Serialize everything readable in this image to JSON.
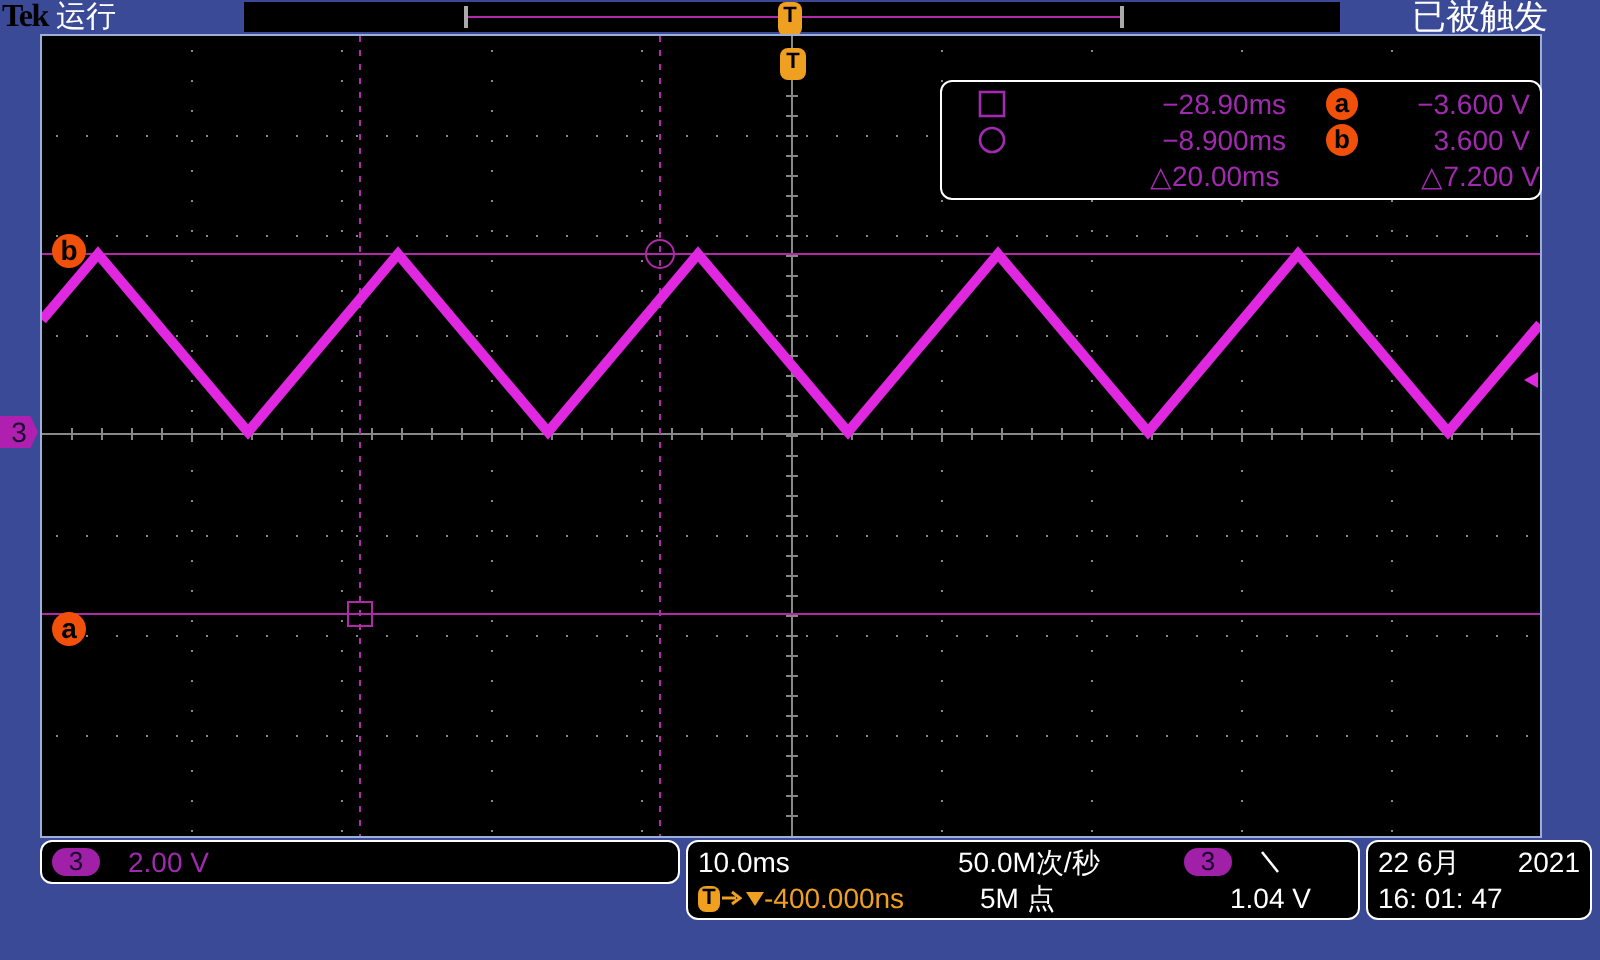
{
  "top_bar": {
    "brand": "Tek",
    "run_state": "运行",
    "trigger_state": "已被触发",
    "trigger_marker": "T"
  },
  "graticule": {
    "trigger_marker": "T",
    "channel_marker": "3",
    "cursor_labels": [
      {
        "label": "b"
      },
      {
        "label": "a"
      }
    ]
  },
  "cursor_readout": {
    "rows": [
      {
        "time": "−28.90ms",
        "label": "a",
        "value": "−3.600 V"
      },
      {
        "time": "−8.900ms",
        "label": "b",
        "value": "3.600 V"
      }
    ],
    "delta_time": "△20.00ms",
    "delta_value": "△7.200 V"
  },
  "channel_panel": {
    "channel": "3",
    "scale": "2.00 V"
  },
  "acquisition_panel": {
    "timebase": "10.0ms",
    "sample_rate": "50.0M次/秒",
    "trigger_icon": "T",
    "trigger_position": "-400.000ns",
    "record_length": "5M 点",
    "trigger_channel": "3",
    "trigger_level": "1.04 V"
  },
  "clock_panel": {
    "date": "22 6月",
    "year": "2021",
    "time": "16: 01: 47"
  }
}
